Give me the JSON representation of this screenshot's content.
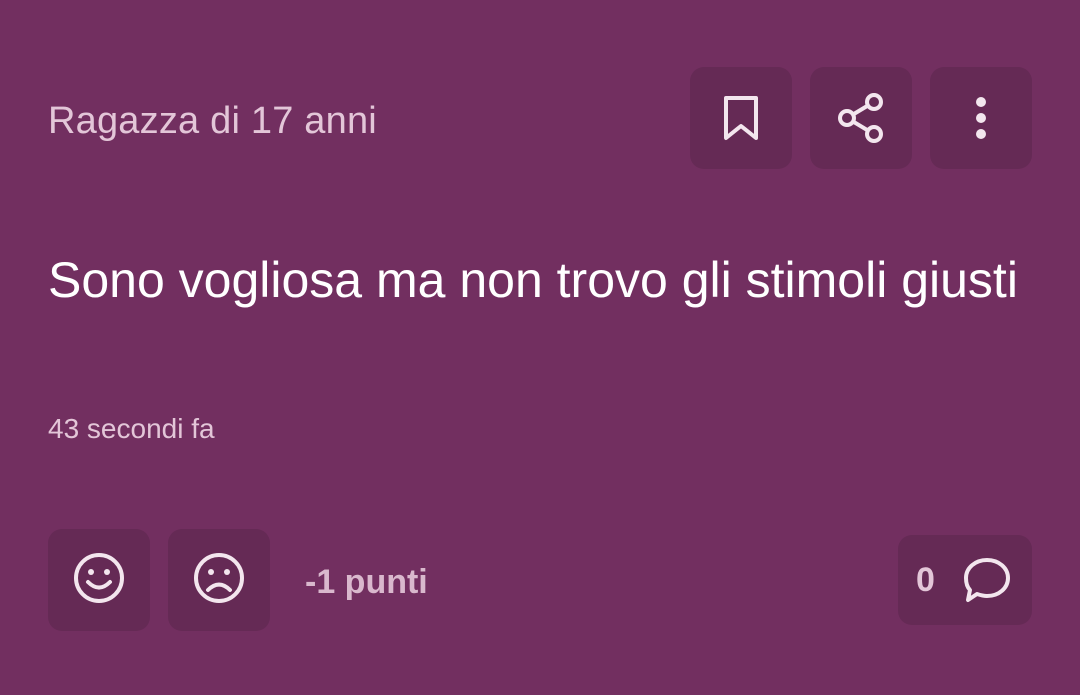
{
  "post": {
    "author": "Ragazza di 17 anni",
    "text": "Sono vogliosa ma non trovo gli stimoli giusti",
    "timestamp": "43 secondi fa",
    "points": "-1 punti",
    "comments_count": "0"
  },
  "icons": {
    "bookmark": "bookmark-icon",
    "share": "share-icon",
    "more": "more-vertical-icon",
    "upvote": "smile-icon",
    "downvote": "frown-icon",
    "comments": "comment-bubble-icon"
  },
  "colors": {
    "background": "#722f60",
    "button_background": "#652a55",
    "primary_text": "#ffffff",
    "secondary_text": "#e3c6d8"
  }
}
